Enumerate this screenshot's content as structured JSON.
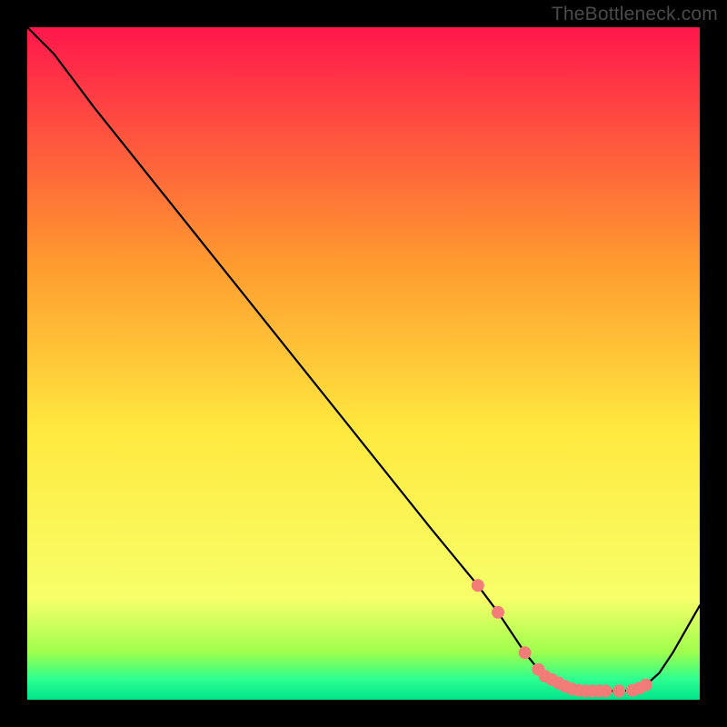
{
  "attribution": "TheBottleneck.com",
  "colors": {
    "bg": "#000000",
    "grad_top": "#ff174c",
    "grad_upper_mid": "#ff9a2f",
    "grad_mid": "#ffe93f",
    "grad_low": "#f7ff69",
    "grad_green_top": "#9dff4d",
    "grad_green_mid": "#2cff91",
    "grad_green_bot": "#00e38a",
    "curve": "#000000",
    "marker_fill": "#f37c78",
    "marker_stroke": "#f37c78"
  },
  "chart_data": {
    "type": "line",
    "title": "",
    "xlabel": "",
    "ylabel": "",
    "xlim": [
      0,
      100
    ],
    "ylim": [
      0,
      100
    ],
    "x": [
      0,
      4,
      10,
      20,
      30,
      40,
      50,
      60,
      67,
      70,
      72,
      74,
      76,
      77,
      78,
      80,
      81,
      82,
      83,
      84,
      86,
      88,
      90,
      91,
      92,
      94,
      96,
      100
    ],
    "values": [
      100,
      96,
      88,
      75.5,
      63,
      50.5,
      38,
      25.5,
      17,
      13,
      10,
      7,
      4.5,
      3.5,
      3.0,
      2.0,
      1.6,
      1.4,
      1.3,
      1.3,
      1.3,
      1.3,
      1.4,
      1.7,
      2.2,
      4,
      7,
      14
    ],
    "markers_x": [
      67,
      70,
      74,
      76,
      77,
      78,
      79,
      80,
      81,
      82,
      83,
      84,
      85,
      86,
      88,
      90,
      91,
      92
    ],
    "markers_y": [
      17,
      13,
      7,
      4.5,
      3.5,
      3.0,
      2.5,
      2.0,
      1.6,
      1.4,
      1.3,
      1.3,
      1.3,
      1.3,
      1.3,
      1.4,
      1.7,
      2.2
    ],
    "series": [
      {
        "name": "bottleneck-curve",
        "values_ref": "values"
      }
    ]
  }
}
